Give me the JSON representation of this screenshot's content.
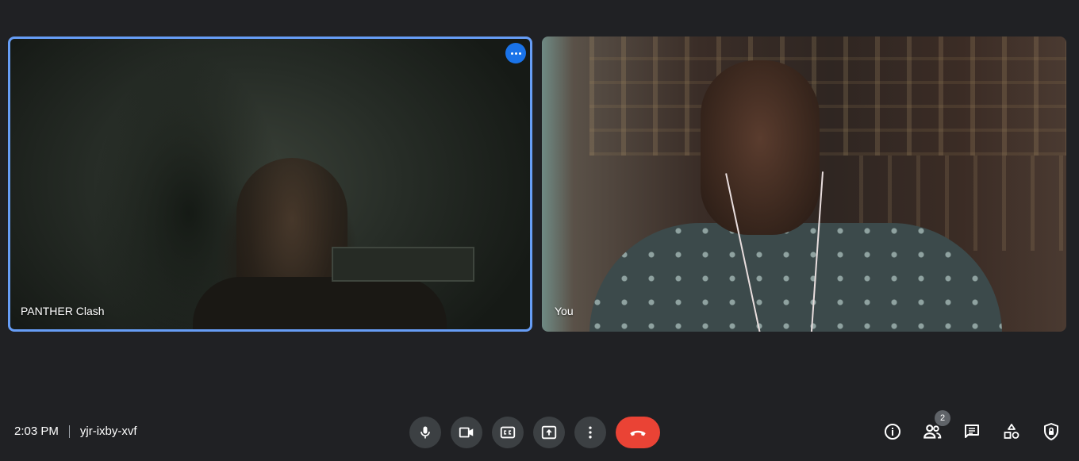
{
  "participants": [
    {
      "name": "PANTHER Clash",
      "active_speaker": true
    },
    {
      "name": "You",
      "active_speaker": false
    }
  ],
  "meeting": {
    "time": "2:03 PM",
    "code": "yjr-ixby-xvf"
  },
  "controls": {
    "microphone_icon": "mic-icon",
    "camera_icon": "videocam-icon",
    "captions_icon": "closed-captions-icon",
    "present_icon": "present-screen-icon",
    "more_icon": "more-vert-icon",
    "leave_icon": "call-end-icon"
  },
  "side_panel": {
    "people_count": "2",
    "icons": [
      "info-icon",
      "people-icon",
      "chat-icon",
      "activities-icon",
      "host-controls-icon"
    ]
  },
  "colors": {
    "background": "#202124",
    "active_speaker_border": "#669df6",
    "leave_button": "#ea4335",
    "control_button": "#3c4043",
    "badge_blue": "#1a73e8"
  }
}
